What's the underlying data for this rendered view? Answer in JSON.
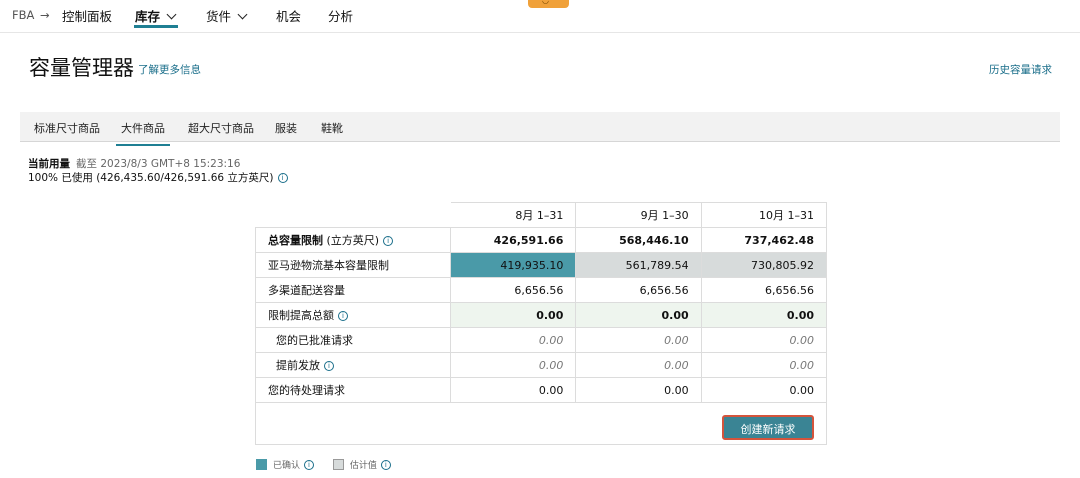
{
  "nav": {
    "root": "FBA",
    "items": [
      {
        "label": "控制面板"
      },
      {
        "label": "库存"
      },
      {
        "label": "货件"
      },
      {
        "label": "机会"
      },
      {
        "label": "分析"
      }
    ]
  },
  "header": {
    "title": "容量管理器",
    "learn_more": "了解更多信息",
    "history": "历史容量请求"
  },
  "tabs": [
    "标准尺寸商品",
    "大件商品",
    "超大尺寸商品",
    "服装",
    "鞋靴"
  ],
  "usage": {
    "label": "当前用量",
    "asof": "截至 2023/8/3 GMT+8 15:23:16",
    "used": "100% 已使用 (426,435.60/426,591.66 立方英尺)"
  },
  "table": {
    "columns": [
      "8月 1–31",
      "9月 1–30",
      "10月 1–31"
    ],
    "rows": [
      {
        "label": "总容量限制",
        "unit": "(立方英尺)",
        "values": [
          "426,591.66",
          "568,446.10",
          "737,462.48"
        ]
      },
      {
        "label": "亚马逊物流基本容量限制",
        "values": [
          "419,935.10",
          "561,789.54",
          "730,805.92"
        ]
      },
      {
        "label": "多渠道配送容量",
        "values": [
          "6,656.56",
          "6,656.56",
          "6,656.56"
        ]
      },
      {
        "label": "限制提高总额",
        "values": [
          "0.00",
          "0.00",
          "0.00"
        ]
      },
      {
        "label": "您的已批准请求",
        "values": [
          "0.00",
          "0.00",
          "0.00"
        ]
      },
      {
        "label": "提前发放",
        "values": [
          "0.00",
          "0.00",
          "0.00"
        ]
      },
      {
        "label": "您的待处理请求",
        "values": [
          "0.00",
          "0.00",
          "0.00"
        ]
      }
    ],
    "button": "创建新请求"
  },
  "legend": {
    "confirmed": "已确认",
    "estimated": "估计值"
  },
  "colors": {
    "confirmed": "#4a9aa8",
    "estimated": "#d7dbdb",
    "accent": "#1f7f93"
  }
}
